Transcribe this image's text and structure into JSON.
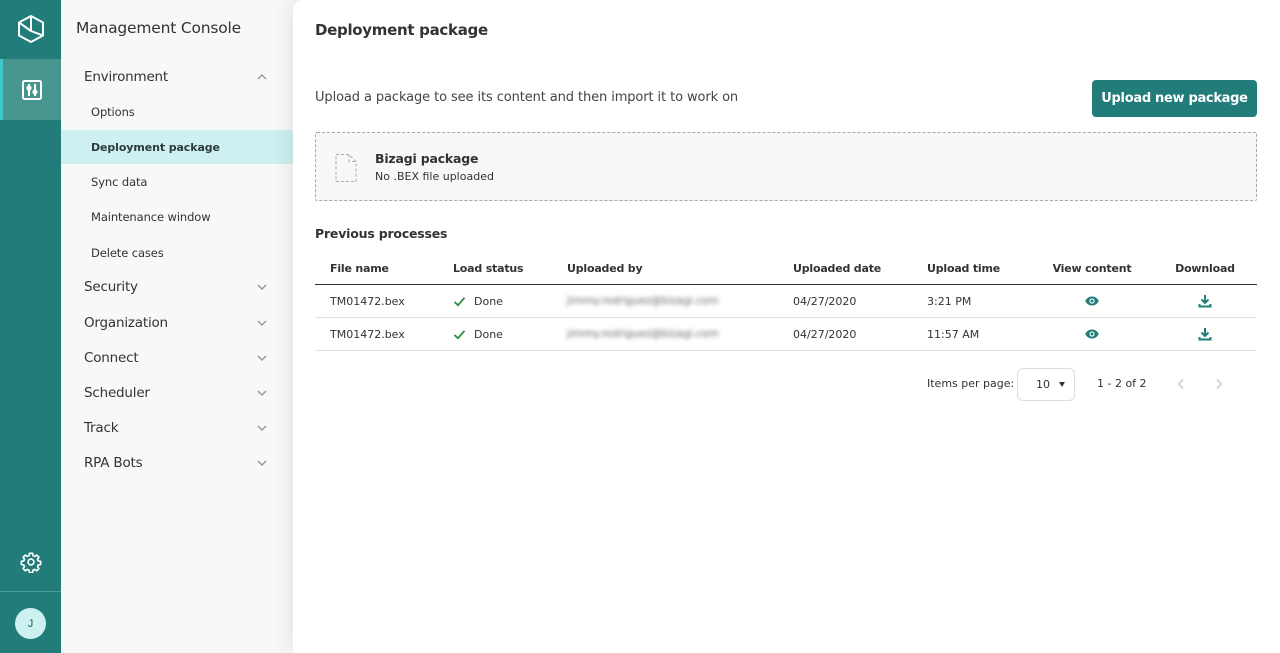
{
  "rail": {
    "logo_icon": "hexagon-cube-logo-icon",
    "active_item_icon": "sliders-icon",
    "settings_icon": "gear-icon",
    "avatar_initial": "J"
  },
  "sidebar": {
    "title": "Management Console",
    "groups": [
      {
        "label": "Environment",
        "expanded": true,
        "items": [
          {
            "label": "Options",
            "active": false
          },
          {
            "label": "Deployment package",
            "active": true
          },
          {
            "label": "Sync data",
            "active": false
          },
          {
            "label": "Maintenance window",
            "active": false
          },
          {
            "label": "Delete cases",
            "active": false
          }
        ]
      },
      {
        "label": "Security",
        "expanded": false
      },
      {
        "label": "Organization",
        "expanded": false
      },
      {
        "label": "Connect",
        "expanded": false
      },
      {
        "label": "Scheduler",
        "expanded": false
      },
      {
        "label": "Track",
        "expanded": false
      },
      {
        "label": "RPA Bots",
        "expanded": false
      }
    ]
  },
  "main": {
    "title": "Deployment package",
    "subtitle": "Upload a package to see its content and then import it to work on",
    "upload_button": "Upload new package",
    "package": {
      "icon": "file-outline-icon",
      "name": "Bizagi package",
      "status": "No .BEX file uploaded"
    },
    "section_title": "Previous processes",
    "table": {
      "columns": [
        "File name",
        "Load status",
        "Uploaded by",
        "Uploaded date",
        "Upload time",
        "View content",
        "Download"
      ],
      "rows": [
        {
          "file_name": "TM01472.bex",
          "status": "Done",
          "uploaded_by": "jimmy.rodriguez@bizagi.com",
          "date": "04/27/2020",
          "time": "3:21 PM"
        },
        {
          "file_name": "TM01472.bex",
          "status": "Done",
          "uploaded_by": "jimmy.rodriguez@bizagi.com",
          "date": "04/27/2020",
          "time": "11:57 AM"
        }
      ]
    },
    "pagination": {
      "items_per_page_label": "Items per page:",
      "items_per_page": "10",
      "range": "1 - 2 of 2"
    }
  },
  "colors": {
    "brand": "#227c7a",
    "active_nav_bg": "#cef0f0",
    "success": "#2e8b3e"
  }
}
